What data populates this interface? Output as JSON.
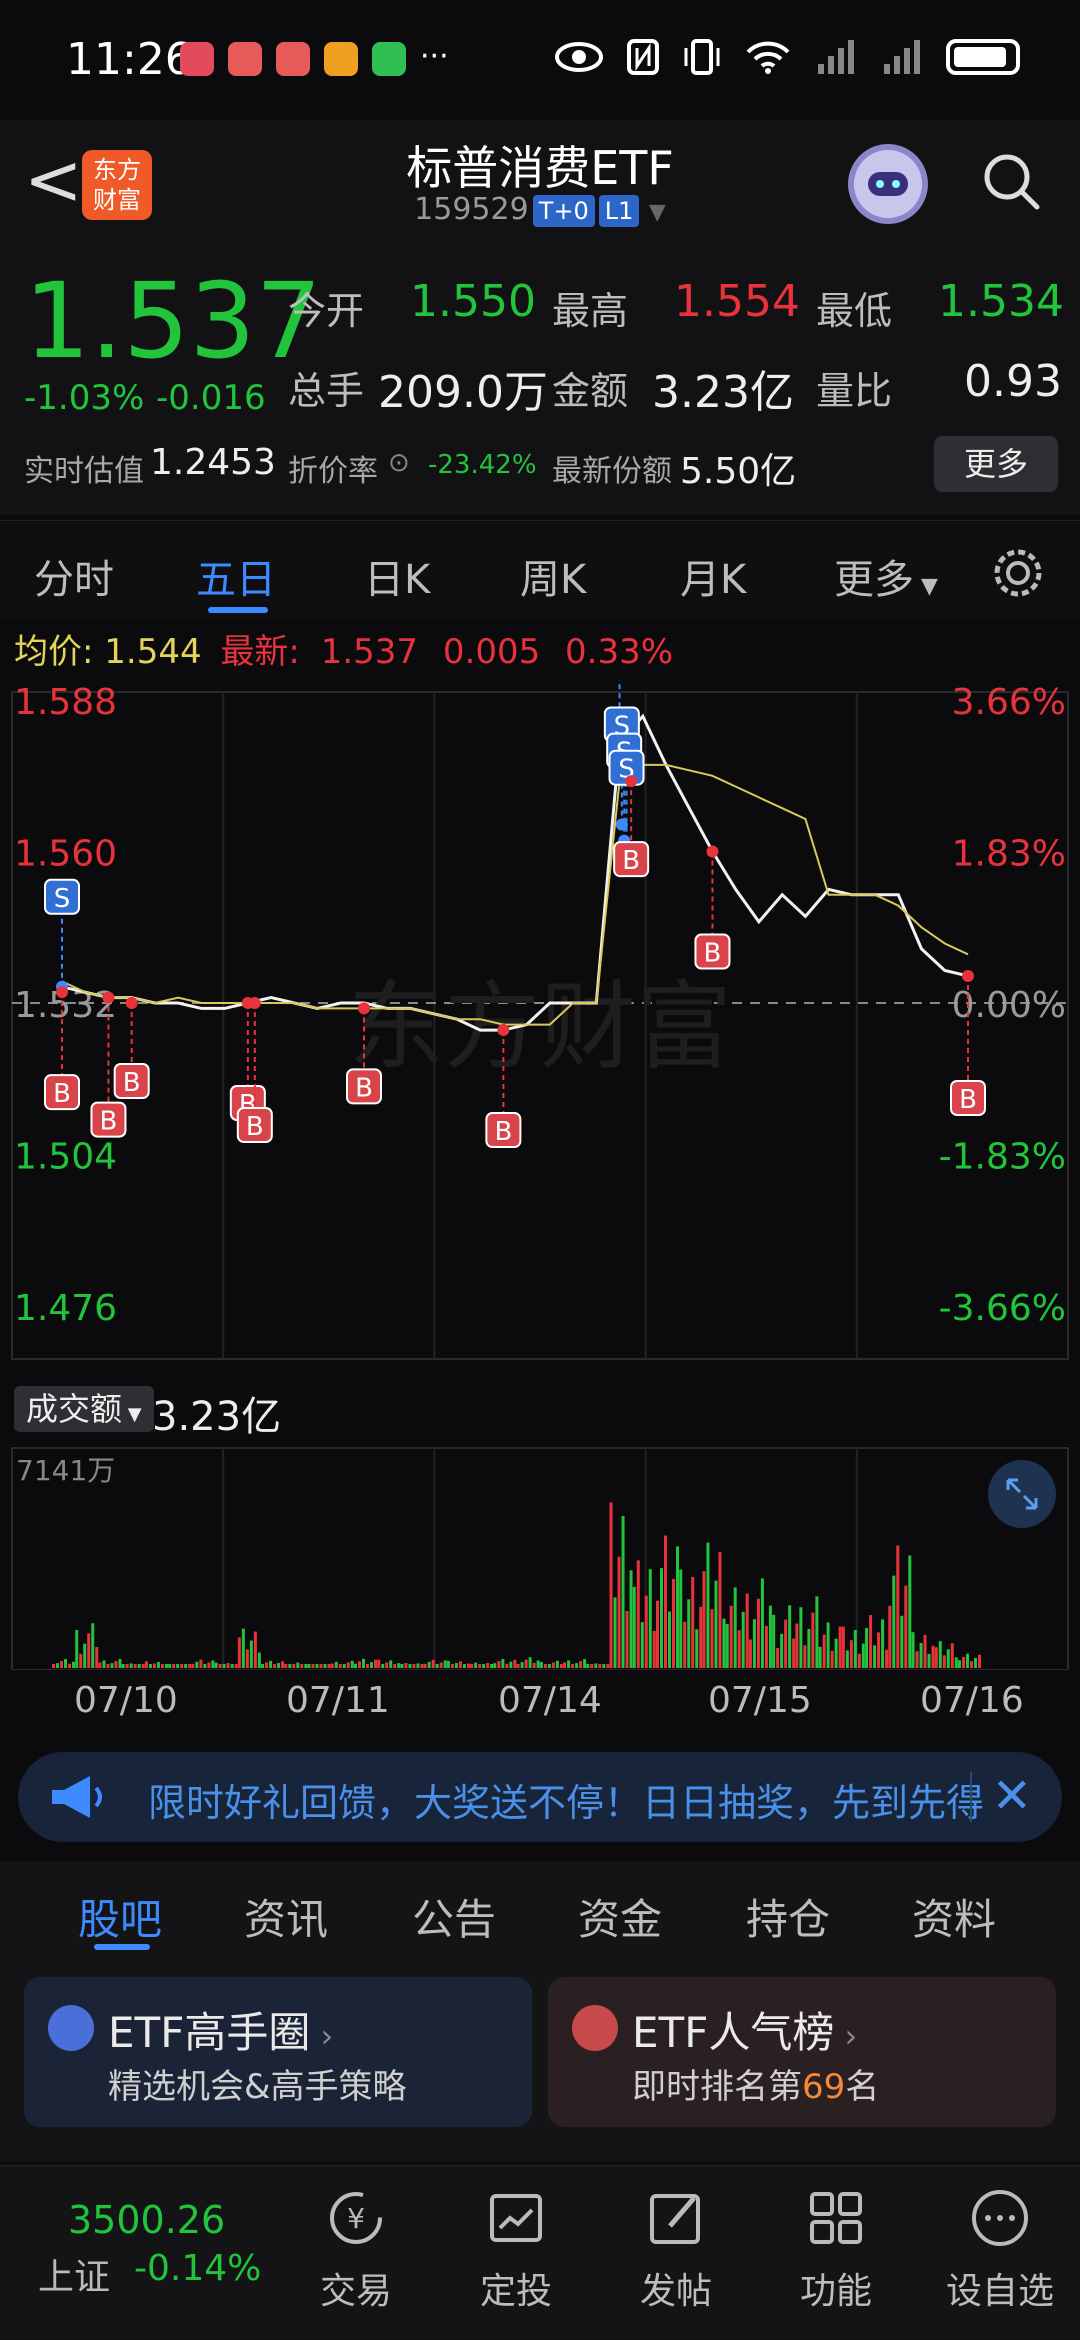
{
  "status_bar": {
    "time": "11:26",
    "dots": "···"
  },
  "header": {
    "back_label": "<",
    "logo_text_1": "东方",
    "logo_text_2": "财富",
    "title": "标普消费ETF",
    "code": "159529",
    "tag1": "T+0",
    "tag2": "L1"
  },
  "quote": {
    "price": "1.537",
    "change_pct": "-1.03%",
    "change": "-0.016",
    "open_label": "今开",
    "open": "1.550",
    "high_label": "最高",
    "high": "1.554",
    "low_label": "最低",
    "low": "1.534",
    "volume_label": "总手",
    "volume": "209.0万",
    "amount_label": "金额",
    "amount": "3.23亿",
    "ratio_label": "量比",
    "ratio": "0.93",
    "est_label": "实时估值",
    "est": "1.2453",
    "discount_label": "折价率",
    "discount": "-23.42%",
    "shares_label": "最新份额",
    "shares": "5.50亿",
    "more_button": "更多"
  },
  "tabs": [
    "分时",
    "五日",
    "日K",
    "周K",
    "月K",
    "更多"
  ],
  "active_tab": 1,
  "info_line": {
    "avg_label": "均价:",
    "avg": "1.544",
    "latest_label": "最新:",
    "latest": "1.537",
    "change": "0.005",
    "change_pct": "0.33%"
  },
  "chart_data": {
    "type": "line",
    "title": "",
    "y_left_ticks": [
      "1.588",
      "1.560",
      "1.532",
      "1.504",
      "1.476"
    ],
    "y_right_ticks": [
      "3.66%",
      "1.83%",
      "0.00%",
      "-1.83%",
      "-3.66%"
    ],
    "ylim": [
      1.476,
      1.588
    ],
    "baseline": 1.532,
    "x_categories": [
      "07/10",
      "07/11",
      "07/14",
      "07/15",
      "07/16"
    ],
    "watermark": "东方财富",
    "series": [
      {
        "values": [
          1.535,
          1.534,
          1.533,
          1.533,
          1.532,
          1.532,
          1.531,
          1.531,
          1.532,
          1.533,
          1.532,
          1.531,
          1.532,
          1.532,
          1.531,
          1.531,
          1.53,
          1.529,
          1.527,
          1.527,
          1.528,
          1.532,
          1.532,
          1.532,
          1.58,
          1.585,
          1.576,
          1.568,
          1.56,
          1.553,
          1.547,
          1.552,
          1.548,
          1.553,
          1.552,
          1.552,
          1.552,
          1.542,
          1.538,
          1.537
        ]
      },
      {
        "values": [
          1.536,
          1.534,
          1.533,
          1.533,
          1.532,
          1.533,
          1.532,
          1.532,
          1.532,
          1.532,
          1.532,
          1.531,
          1.531,
          1.531,
          1.531,
          1.531,
          1.53,
          1.529,
          1.529,
          1.528,
          1.528,
          1.528,
          1.532,
          1.532,
          1.573,
          1.576,
          1.576,
          1.575,
          1.574,
          1.572,
          1.57,
          1.568,
          1.566,
          1.552,
          1.552,
          1.552,
          1.55,
          1.546,
          1.543,
          1.541
        ]
      }
    ],
    "markers": [
      {
        "type": "S",
        "index": 0,
        "value": 1.535
      },
      {
        "type": "B",
        "index": 0,
        "value": 1.534
      },
      {
        "type": "B",
        "index": 2,
        "value": 1.533
      },
      {
        "type": "B",
        "index": 3,
        "value": 1.532
      },
      {
        "type": "B",
        "index": 8,
        "value": 1.532
      },
      {
        "type": "B",
        "index": 8.3,
        "value": 1.532
      },
      {
        "type": "B",
        "index": 13,
        "value": 1.531
      },
      {
        "type": "B",
        "index": 19,
        "value": 1.527
      },
      {
        "type": "S",
        "index": 24,
        "value": 1.58
      },
      {
        "type": "S",
        "index": 24.1,
        "value": 1.565
      },
      {
        "type": "S",
        "index": 24.2,
        "value": 1.562
      },
      {
        "type": "S",
        "index": 24.3,
        "value": 1.557
      },
      {
        "type": "B",
        "index": 24.5,
        "value": 1.573
      },
      {
        "type": "B",
        "index": 28,
        "value": 1.56
      },
      {
        "type": "B",
        "index": 39,
        "value": 1.537
      }
    ]
  },
  "volume": {
    "label": "成交额",
    "total": "3.23亿",
    "max_label": "7141万",
    "values": [
      0.05,
      0.25,
      0.05,
      0.03,
      0.04,
      0.02,
      0.05,
      0.03,
      0.22,
      0.04,
      0.03,
      0.02,
      0.04,
      0.06,
      0.05,
      0.03,
      0.05,
      0.04,
      0.03,
      0.05,
      0.06,
      0.04,
      0.05,
      0.03,
      1.0,
      0.65,
      0.8,
      0.55,
      0.7,
      0.45,
      0.5,
      0.35,
      0.4,
      0.3,
      0.25,
      0.32,
      0.74,
      0.2,
      0.15,
      0.08
    ]
  },
  "banner": {
    "text": "限时好礼回馈，大奖送不停！日日抽奖，先到先得"
  },
  "bottom_tabs": [
    "股吧",
    "资讯",
    "公告",
    "资金",
    "持仓",
    "资料"
  ],
  "cards": [
    {
      "title": "ETF高手圈",
      "subtitle": "精选机会&高手策略"
    },
    {
      "title": "ETF人气榜",
      "subtitle_pre": "即时排名第",
      "rank": "69",
      "subtitle_post": "名"
    }
  ],
  "index": {
    "value": "3500.26",
    "name": "上证",
    "change": "-0.14%"
  },
  "nav": [
    "交易",
    "定投",
    "发帖",
    "功能",
    "设自选"
  ],
  "colors": {
    "up": "#e8323c",
    "down": "#21c43b",
    "accent": "#3d8bff",
    "avg_line": "#d9c95a"
  }
}
